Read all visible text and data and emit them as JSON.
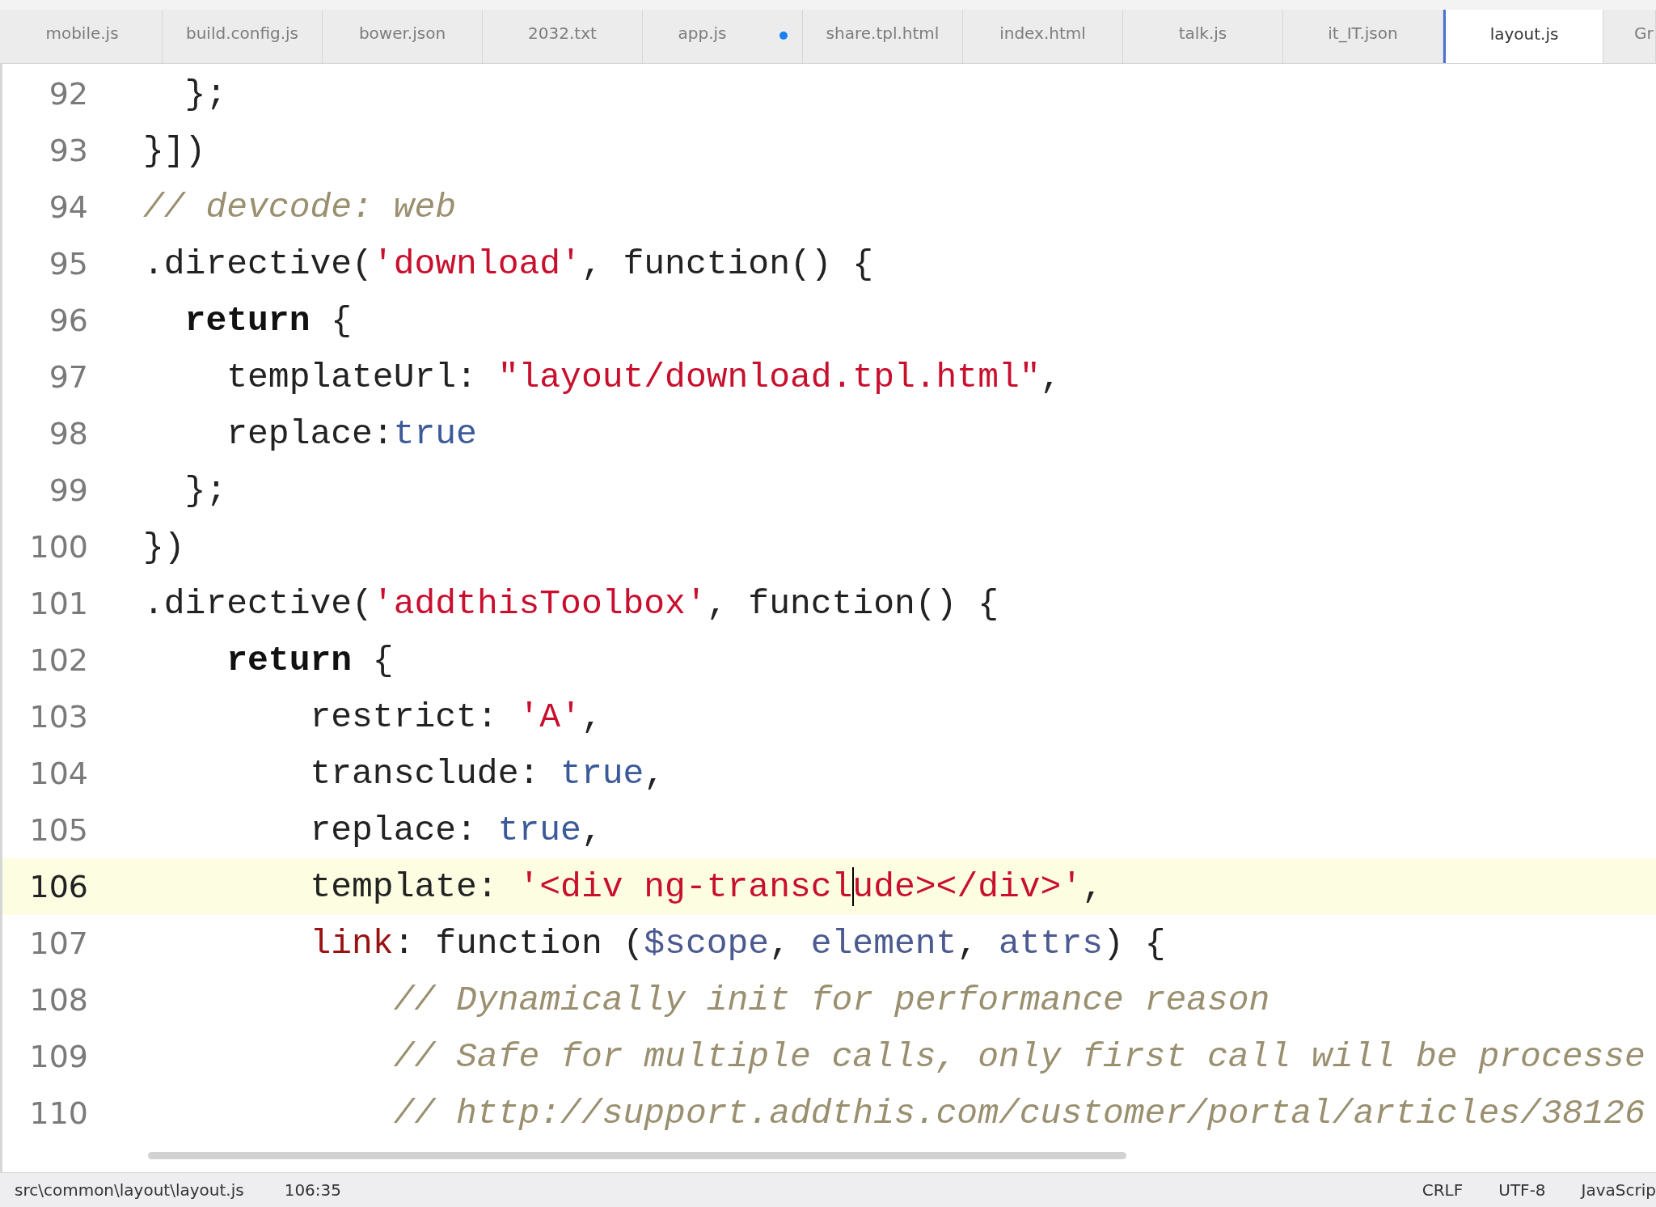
{
  "tabs": [
    {
      "label": "mobile.js",
      "selected": false,
      "modified": false
    },
    {
      "label": "build.config.js",
      "selected": false,
      "modified": false
    },
    {
      "label": "bower.json",
      "selected": false,
      "modified": false
    },
    {
      "label": "2032.txt",
      "selected": false,
      "modified": false
    },
    {
      "label": "app.js",
      "selected": false,
      "modified": true
    },
    {
      "label": "share.tpl.html",
      "selected": false,
      "modified": false
    },
    {
      "label": "index.html",
      "selected": false,
      "modified": false
    },
    {
      "label": "talk.js",
      "selected": false,
      "modified": false
    },
    {
      "label": "it_IT.json",
      "selected": false,
      "modified": false
    },
    {
      "label": "layout.js",
      "selected": true,
      "modified": false
    },
    {
      "label": "Gr",
      "selected": false,
      "modified": false
    }
  ],
  "editor": {
    "lines": [
      {
        "number": "92",
        "current": false,
        "tokens": [
          {
            "kind": "plain",
            "text": "  };"
          }
        ]
      },
      {
        "number": "93",
        "current": false,
        "tokens": [
          {
            "kind": "plain",
            "text": "}])"
          }
        ]
      },
      {
        "number": "94",
        "current": false,
        "tokens": [
          {
            "kind": "comment",
            "text": "// devcode: web"
          }
        ]
      },
      {
        "number": "95",
        "current": false,
        "tokens": [
          {
            "kind": "plain",
            "text": ".directive("
          },
          {
            "kind": "string",
            "text": "'download'"
          },
          {
            "kind": "plain",
            "text": ", function() {"
          }
        ]
      },
      {
        "number": "96",
        "current": false,
        "tokens": [
          {
            "kind": "keyword",
            "text": "  return"
          },
          {
            "kind": "plain",
            "text": " {"
          }
        ]
      },
      {
        "number": "97",
        "current": false,
        "tokens": [
          {
            "kind": "plain",
            "text": "    templateUrl: "
          },
          {
            "kind": "string",
            "text": "\"layout/download.tpl.html\""
          },
          {
            "kind": "plain",
            "text": ","
          }
        ]
      },
      {
        "number": "98",
        "current": false,
        "tokens": [
          {
            "kind": "plain",
            "text": "    replace:"
          },
          {
            "kind": "literal",
            "text": "true"
          }
        ]
      },
      {
        "number": "99",
        "current": false,
        "tokens": [
          {
            "kind": "plain",
            "text": "  };"
          }
        ]
      },
      {
        "number": "100",
        "current": false,
        "tokens": [
          {
            "kind": "plain",
            "text": "})"
          }
        ]
      },
      {
        "number": "101",
        "current": false,
        "tokens": [
          {
            "kind": "plain",
            "text": ".directive("
          },
          {
            "kind": "string",
            "text": "'addthisToolbox'"
          },
          {
            "kind": "plain",
            "text": ", function() {"
          }
        ]
      },
      {
        "number": "102",
        "current": false,
        "tokens": [
          {
            "kind": "keyword",
            "text": "    return"
          },
          {
            "kind": "plain",
            "text": " {"
          }
        ]
      },
      {
        "number": "103",
        "current": false,
        "tokens": [
          {
            "kind": "plain",
            "text": "        restrict: "
          },
          {
            "kind": "string",
            "text": "'A'"
          },
          {
            "kind": "plain",
            "text": ","
          }
        ]
      },
      {
        "number": "104",
        "current": false,
        "tokens": [
          {
            "kind": "plain",
            "text": "        transclude: "
          },
          {
            "kind": "literal",
            "text": "true"
          },
          {
            "kind": "plain",
            "text": ","
          }
        ]
      },
      {
        "number": "105",
        "current": false,
        "tokens": [
          {
            "kind": "plain",
            "text": "        replace: "
          },
          {
            "kind": "literal",
            "text": "true"
          },
          {
            "kind": "plain",
            "text": ","
          }
        ]
      },
      {
        "number": "106",
        "current": true,
        "tokens": [
          {
            "kind": "plain",
            "text": "        template: "
          },
          {
            "kind": "string",
            "text": "'<div ng-transcl"
          },
          {
            "kind": "cursor"
          },
          {
            "kind": "string",
            "text": "ude></div>'"
          },
          {
            "kind": "plain",
            "text": ","
          }
        ]
      },
      {
        "number": "107",
        "current": false,
        "tokens": [
          {
            "kind": "property",
            "text": "        link"
          },
          {
            "kind": "plain",
            "text": ": function ("
          },
          {
            "kind": "variable",
            "text": "$scope"
          },
          {
            "kind": "plain",
            "text": ", "
          },
          {
            "kind": "variable",
            "text": "element"
          },
          {
            "kind": "plain",
            "text": ", "
          },
          {
            "kind": "variable",
            "text": "attrs"
          },
          {
            "kind": "plain",
            "text": ") {"
          }
        ]
      },
      {
        "number": "108",
        "current": false,
        "tokens": [
          {
            "kind": "comment",
            "text": "            // Dynamically init for performance reason"
          }
        ]
      },
      {
        "number": "109",
        "current": false,
        "tokens": [
          {
            "kind": "comment",
            "text": "            // Safe for multiple calls, only first call will be processe"
          }
        ]
      },
      {
        "number": "110",
        "current": false,
        "tokens": [
          {
            "kind": "comment",
            "text": "            // http://support.addthis.com/customer/portal/articles/38126"
          }
        ]
      }
    ]
  },
  "status_bar": {
    "file_path": "src\\common\\layout\\layout.js",
    "cursor_position": "106:35",
    "line_ending": "CRLF",
    "encoding": "UTF-8",
    "language": "JavaScrip"
  }
}
